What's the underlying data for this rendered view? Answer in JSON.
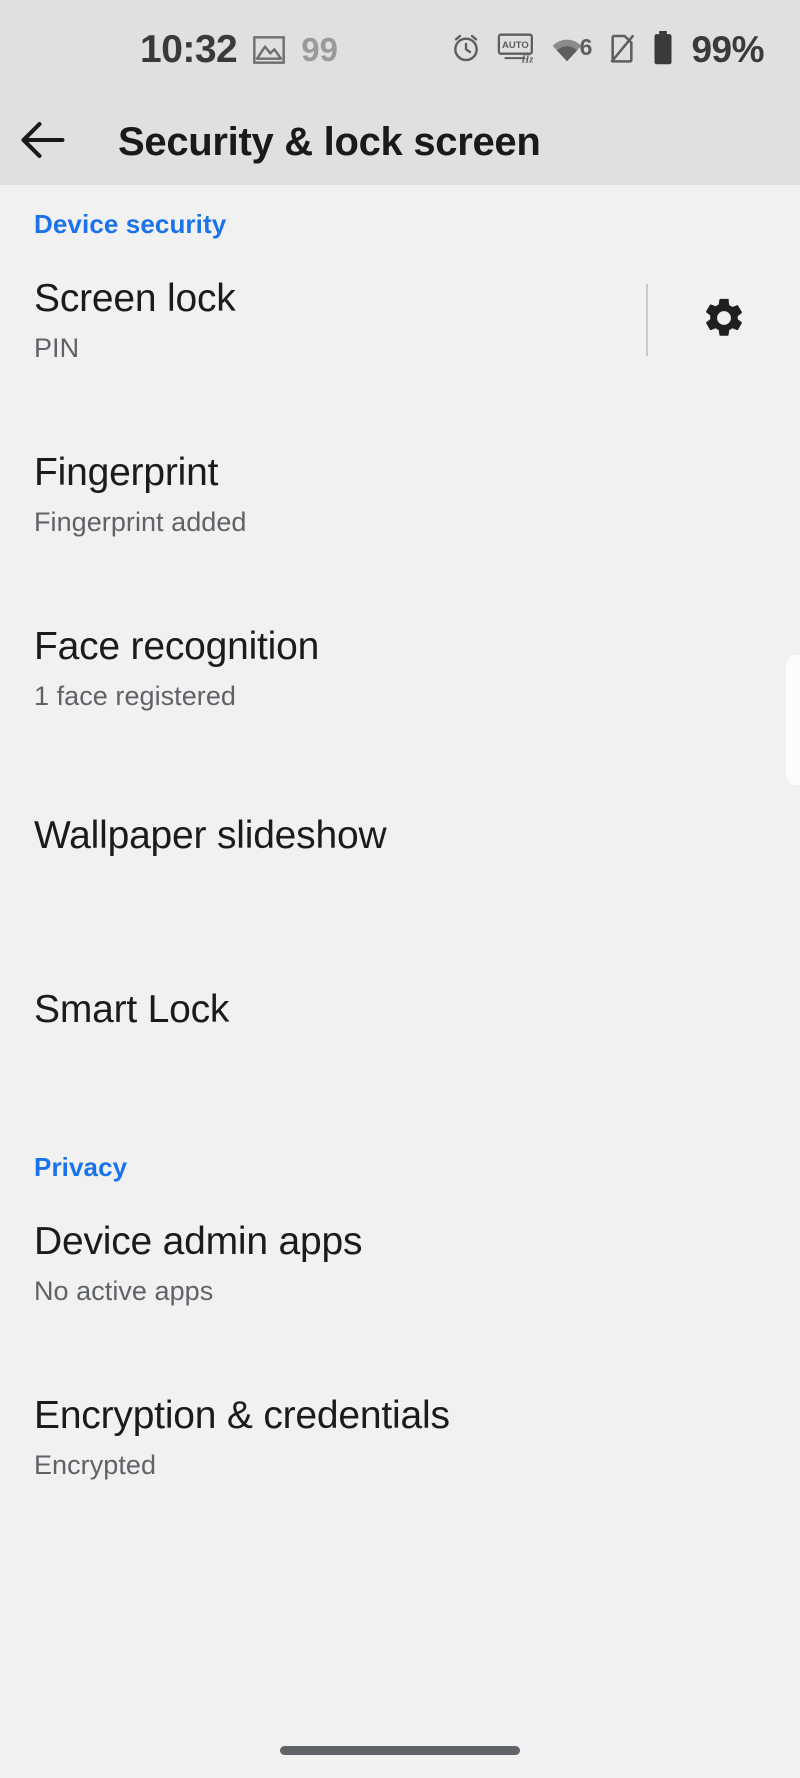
{
  "status_bar": {
    "time": "10:32",
    "notification_count": "99",
    "battery_percent": "99%",
    "wifi_generation": "6",
    "icons": [
      "image-icon",
      "alarm-icon",
      "auto-hz-refresh-rate-icon",
      "wifi-icon",
      "no-sim-icon",
      "battery-icon"
    ]
  },
  "app_bar": {
    "back_icon": "back-arrow-icon",
    "title": "Security & lock screen"
  },
  "colors": {
    "section_header": "#1a73e8",
    "status_bar_bg": "#e0e0e0",
    "page_bg": "#f1f1f1",
    "title_text": "#1b1b1b",
    "subtitle_text": "#5f6368"
  },
  "sections": [
    {
      "header": "Device security",
      "rows": [
        {
          "title": "Screen lock",
          "subtitle": "PIN",
          "has_settings_gear": true,
          "gear_icon": "gear-icon"
        },
        {
          "title": "Fingerprint",
          "subtitle": "Fingerprint added",
          "has_settings_gear": false
        },
        {
          "title": "Face recognition",
          "subtitle": "1 face registered",
          "has_settings_gear": false
        },
        {
          "title": "Wallpaper slideshow",
          "subtitle": "",
          "has_settings_gear": false
        },
        {
          "title": "Smart Lock",
          "subtitle": "",
          "has_settings_gear": false
        }
      ]
    },
    {
      "header": "Privacy",
      "rows": [
        {
          "title": "Device admin apps",
          "subtitle": "No active apps",
          "has_settings_gear": false
        },
        {
          "title": "Encryption & credentials",
          "subtitle": "Encrypted",
          "has_settings_gear": false
        }
      ]
    }
  ],
  "navigation": {
    "gesture_pill": "home-gesture-pill"
  }
}
